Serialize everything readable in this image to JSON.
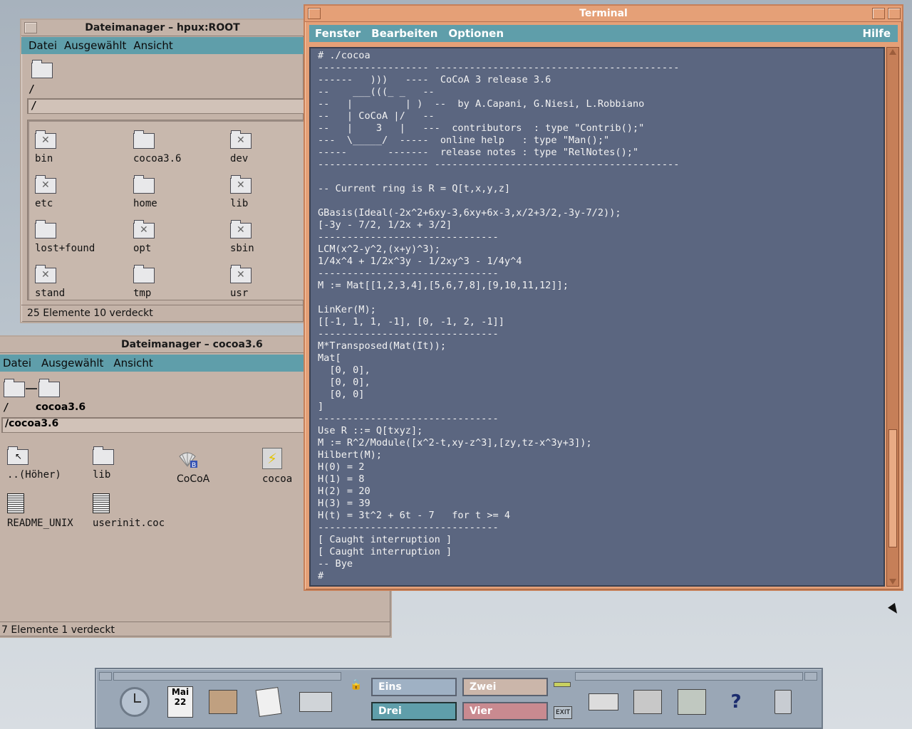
{
  "fm_root": {
    "title": "Dateimanager – hpux:ROOT",
    "menu": [
      "Datei",
      "Ausgewählt",
      "Ansicht"
    ],
    "breadcrumb": "/",
    "path": "/",
    "items": [
      {
        "label": "bin",
        "icon": "folder-link-icon"
      },
      {
        "label": "cocoa3.6",
        "icon": "folder-icon"
      },
      {
        "label": "dev",
        "icon": "folder-link-icon"
      },
      {
        "label": "etc",
        "icon": "folder-link-icon"
      },
      {
        "label": "home",
        "icon": "folder-icon"
      },
      {
        "label": "lib",
        "icon": "folder-link-icon"
      },
      {
        "label": "lost+found",
        "icon": "folder-icon"
      },
      {
        "label": "opt",
        "icon": "folder-link-icon"
      },
      {
        "label": "sbin",
        "icon": "folder-link-icon"
      },
      {
        "label": "stand",
        "icon": "folder-link-icon"
      },
      {
        "label": "tmp",
        "icon": "folder-icon"
      },
      {
        "label": "usr",
        "icon": "folder-link-icon"
      }
    ],
    "status": "25 Elemente 10 verdeckt"
  },
  "fm_cocoa": {
    "title": "Dateimanager – cocoa3.6",
    "menu": [
      "Datei",
      "Ausgewählt",
      "Ansicht"
    ],
    "crumb_root": "/",
    "crumb_dir": "cocoa3.6",
    "path": "/cocoa3.6",
    "items": [
      {
        "label": "..(Höher)",
        "icon": "parent-folder-icon"
      },
      {
        "label": "lib",
        "icon": "folder-icon"
      },
      {
        "label": "CoCoA",
        "icon": "cocoa-app-icon"
      },
      {
        "label": "cocoa",
        "icon": "executable-icon"
      },
      {
        "label": "README_UNIX",
        "icon": "text-file-icon"
      },
      {
        "label": "userinit.coc",
        "icon": "text-file-icon"
      }
    ],
    "status": "7 Elemente 1 verdeckt"
  },
  "terminal": {
    "title": "Terminal",
    "menu": [
      "Fenster",
      "Bearbeiten",
      "Optionen"
    ],
    "help": "Hilfe",
    "lines": [
      "# ./cocoa",
      "------------------- ------------------------------------------",
      "------   )))   ----  CoCoA 3 release 3.6",
      "--    ___(((_ _   --",
      "--   |         | )  --  by A.Capani, G.Niesi, L.Robbiano",
      "--   | CoCoA |/   --",
      "--   |    3   |   ---  contributors  : type \"Contrib();\"",
      "---  \\_____/  -----  online help   : type \"Man();\"",
      "-----       -------  release notes : type \"RelNotes();\"",
      "------------------- ------------------------------------------",
      "",
      "-- Current ring is R = Q[t,x,y,z]",
      "",
      "GBasis(Ideal(-2x^2+6xy-3,6xy+6x-3,x/2+3/2,-3y-7/2));",
      "[-3y - 7/2, 1/2x + 3/2]",
      "-------------------------------",
      "LCM(x^2-y^2,(x+y)^3);",
      "1/4x^4 + 1/2x^3y - 1/2xy^3 - 1/4y^4",
      "-------------------------------",
      "M := Mat[[1,2,3,4],[5,6,7,8],[9,10,11,12]];",
      "",
      "LinKer(M);",
      "[[-1, 1, 1, -1], [0, -1, 2, -1]]",
      "-------------------------------",
      "M*Transposed(Mat(It));",
      "Mat[",
      "  [0, 0],",
      "  [0, 0],",
      "  [0, 0]",
      "]",
      "-------------------------------",
      "Use R ::= Q[txyz];",
      "M := R^2/Module([x^2-t,xy-z^3],[zy,tz-x^3y+3]);",
      "Hilbert(M);",
      "H(0) = 2",
      "H(1) = 8",
      "H(2) = 20",
      "H(3) = 39",
      "H(t) = 3t^2 + 6t - 7   for t >= 4",
      "-------------------------------",
      "[ Caught interruption ]",
      "[ Caught interruption ]",
      "-- Bye",
      "#"
    ]
  },
  "panel": {
    "date_month": "Mai",
    "date_day": "22",
    "workspaces": [
      "Eins",
      "Zwei",
      "Drei",
      "Vier"
    ],
    "exit_label": "EXIT",
    "colors": {
      "eins": "#9fb1c4",
      "zwei": "#cbb6aa",
      "drei": "#5f9eaa",
      "vier": "#c98a90"
    }
  }
}
